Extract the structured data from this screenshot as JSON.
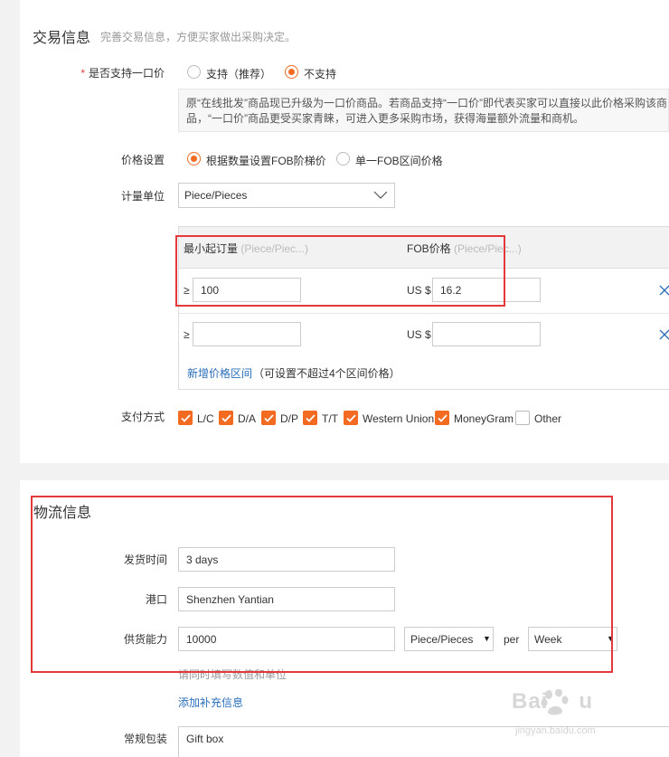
{
  "trade": {
    "title": "交易信息",
    "subtitle": "完善交易信息，方便买家做出采购决定。",
    "one_price": {
      "label": "是否支持一口价",
      "option_yes": "支持（推荐）",
      "option_no": "不支持",
      "selected": "不支持",
      "notice": "原“在线批发”商品现已升级为一口价商品。若商品支持“一口价”即代表买家可以直接以此价格采购该商品，“一口价”商品更受买家青睐，可进入更多采购市场，获得海量额外流量和商机。"
    },
    "price_setting": {
      "label": "价格设置",
      "option_tiered": "根据数量设置FOB阶梯价",
      "option_single": "单一FOB区间价格",
      "selected": "根据数量设置FOB阶梯价"
    },
    "unit": {
      "label": "计量单位",
      "value": "Piece/Pieces"
    },
    "price_table": {
      "col_moq": "最小起订量",
      "col_moq_unit": "(Piece/Piec...)",
      "col_fob": "FOB价格",
      "col_fob_unit": "(Piece/Piec...)",
      "ge_symbol": "≥",
      "currency": "US $",
      "rows": [
        {
          "moq": "100",
          "price": "16.2"
        },
        {
          "moq": "",
          "price": ""
        }
      ],
      "add_link": "新增价格区间",
      "add_hint": "（可设置不超过4个区间价格）"
    },
    "payment": {
      "label": "支付方式",
      "methods": [
        {
          "name": "L/C",
          "checked": true
        },
        {
          "name": "D/A",
          "checked": true
        },
        {
          "name": "D/P",
          "checked": true
        },
        {
          "name": "T/T",
          "checked": true
        },
        {
          "name": "Western Union",
          "checked": true
        },
        {
          "name": "MoneyGram",
          "checked": true
        },
        {
          "name": "Other",
          "checked": false
        }
      ]
    }
  },
  "logistics": {
    "title": "物流信息",
    "delivery_time": {
      "label": "发货时间",
      "value": "3 days"
    },
    "port": {
      "label": "港口",
      "value": "Shenzhen Yantian"
    },
    "supply": {
      "label": "供货能力",
      "value": "10000",
      "unit": "Piece/Pieces",
      "per": "per",
      "period": "Week",
      "hint": "请同时填写数值和单位"
    },
    "add_info_link": "添加补充信息",
    "packaging": {
      "label": "常规包装",
      "value": "Gift box"
    }
  },
  "colors": {
    "accent_orange": "#f26b21",
    "highlight_red": "#e4393c",
    "link_blue": "#2a6ebb"
  }
}
